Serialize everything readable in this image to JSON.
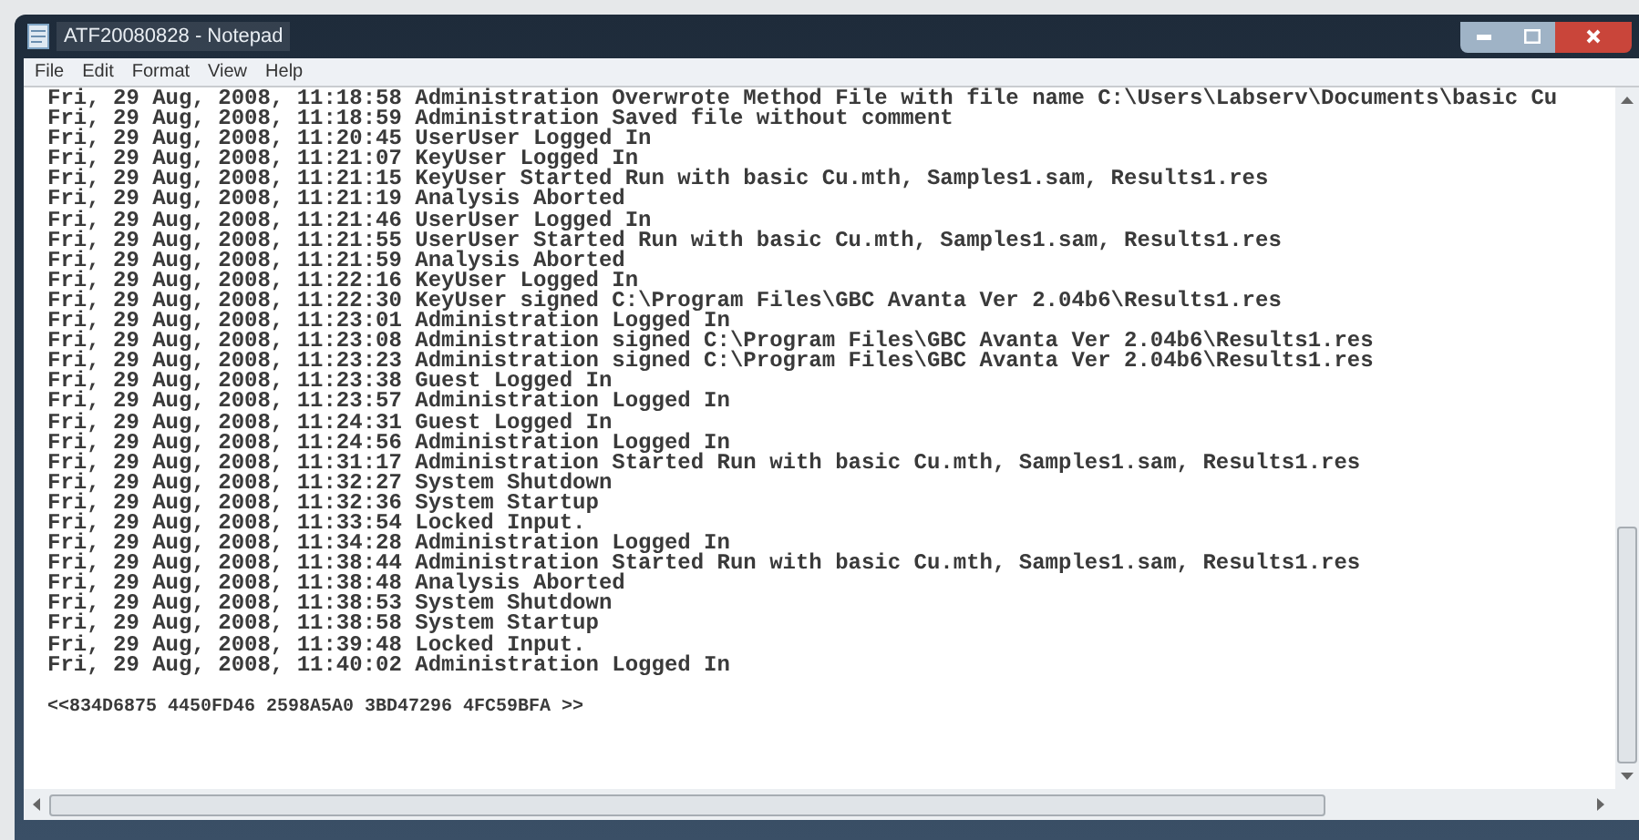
{
  "window": {
    "title": "ATF20080828 - Notepad"
  },
  "menu": [
    "File",
    "Edit",
    "Format",
    "View",
    "Help"
  ],
  "lines": [
    "Fri, 29 Aug, 2008, 11:18:58 Administration Overwrote Method File with file name C:\\Users\\Labserv\\Documents\\basic Cu",
    "Fri, 29 Aug, 2008, 11:18:59 Administration Saved file without comment",
    "Fri, 29 Aug, 2008, 11:20:45 UserUser Logged In",
    "Fri, 29 Aug, 2008, 11:21:07 KeyUser Logged In",
    "Fri, 29 Aug, 2008, 11:21:15 KeyUser Started Run with basic Cu.mth, Samples1.sam, Results1.res",
    "Fri, 29 Aug, 2008, 11:21:19 Analysis Aborted",
    "Fri, 29 Aug, 2008, 11:21:46 UserUser Logged In",
    "Fri, 29 Aug, 2008, 11:21:55 UserUser Started Run with basic Cu.mth, Samples1.sam, Results1.res",
    "Fri, 29 Aug, 2008, 11:21:59 Analysis Aborted",
    "Fri, 29 Aug, 2008, 11:22:16 KeyUser Logged In",
    "Fri, 29 Aug, 2008, 11:22:30 KeyUser signed C:\\Program Files\\GBC Avanta Ver 2.04b6\\Results1.res",
    "Fri, 29 Aug, 2008, 11:23:01 Administration Logged In",
    "Fri, 29 Aug, 2008, 11:23:08 Administration signed C:\\Program Files\\GBC Avanta Ver 2.04b6\\Results1.res",
    "Fri, 29 Aug, 2008, 11:23:23 Administration signed C:\\Program Files\\GBC Avanta Ver 2.04b6\\Results1.res",
    "Fri, 29 Aug, 2008, 11:23:38 Guest Logged In",
    "Fri, 29 Aug, 2008, 11:23:57 Administration Logged In",
    "Fri, 29 Aug, 2008, 11:24:31 Guest Logged In",
    "Fri, 29 Aug, 2008, 11:24:56 Administration Logged In",
    "Fri, 29 Aug, 2008, 11:31:17 Administration Started Run with basic Cu.mth, Samples1.sam, Results1.res",
    "Fri, 29 Aug, 2008, 11:32:27 System Shutdown",
    "Fri, 29 Aug, 2008, 11:32:36 System Startup",
    "Fri, 29 Aug, 2008, 11:33:54 Locked Input.",
    "Fri, 29 Aug, 2008, 11:34:28 Administration Logged In",
    "Fri, 29 Aug, 2008, 11:38:44 Administration Started Run with basic Cu.mth, Samples1.sam, Results1.res",
    "Fri, 29 Aug, 2008, 11:38:48 Analysis Aborted",
    "Fri, 29 Aug, 2008, 11:38:53 System Shutdown",
    "Fri, 29 Aug, 2008, 11:38:58 System Startup",
    "Fri, 29 Aug, 2008, 11:39:48 Locked Input.",
    "Fri, 29 Aug, 2008, 11:40:02 Administration Logged In"
  ],
  "signature": "<<834D6875 4450FD46 2598A5A0 3BD47296 4FC59BFA >>"
}
